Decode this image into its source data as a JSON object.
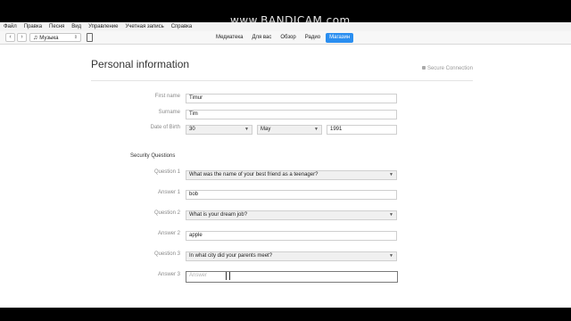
{
  "watermark": "www.BANDICAM.com",
  "menu": [
    "Файл",
    "Правка",
    "Песня",
    "Вид",
    "Управление",
    "Учетная запись",
    "Справка"
  ],
  "toolbar": {
    "back": "‹",
    "forward": "›",
    "media_select": "Музыка"
  },
  "tabs": [
    {
      "label": "Медиатека",
      "active": false
    },
    {
      "label": "Для вас",
      "active": false
    },
    {
      "label": "Обзор",
      "active": false
    },
    {
      "label": "Радио",
      "active": false
    },
    {
      "label": "Магазин",
      "active": true
    }
  ],
  "page": {
    "title": "Personal information",
    "secure": "Secure Connection"
  },
  "personal": {
    "first_name_label": "First name",
    "first_name": "Timur",
    "surname_label": "Surname",
    "surname": "Tim",
    "dob_label": "Date of Birth",
    "day": "30",
    "month": "May",
    "year": "1991"
  },
  "security": {
    "section_label": "Security Questions",
    "q1_label": "Question 1",
    "q1": "What was the name of your best friend as a teenager?",
    "a1_label": "Answer 1",
    "a1": "bob",
    "q2_label": "Question 2",
    "q2": "What is your dream job?",
    "a2_label": "Answer 2",
    "a2": "apple",
    "q3_label": "Question 3",
    "q3": "In what city did your parents meet?",
    "a3_label": "Answer 3",
    "a3_placeholder": "Answer"
  },
  "colors": {
    "accent": "#2a8ef0"
  }
}
